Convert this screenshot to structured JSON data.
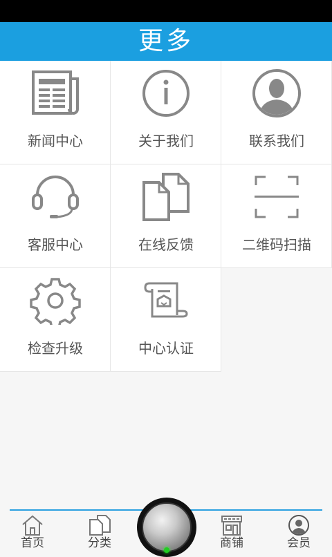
{
  "header": {
    "title": "更多"
  },
  "grid": {
    "items": [
      {
        "label": "新闻中心",
        "icon": "newspaper-icon"
      },
      {
        "label": "关于我们",
        "icon": "info-icon"
      },
      {
        "label": "联系我们",
        "icon": "person-icon"
      },
      {
        "label": "客服中心",
        "icon": "headset-icon"
      },
      {
        "label": "在线反馈",
        "icon": "documents-icon"
      },
      {
        "label": "二维码扫描",
        "icon": "scan-icon"
      },
      {
        "label": "检查升级",
        "icon": "gear-icon"
      },
      {
        "label": "中心认证",
        "icon": "certificate-icon"
      }
    ]
  },
  "tabbar": {
    "tabs": [
      {
        "label": "首页",
        "icon": "home-icon"
      },
      {
        "label": "分类",
        "icon": "category-icon"
      },
      {
        "label": "商铺",
        "icon": "shop-icon"
      },
      {
        "label": "会员",
        "icon": "member-icon"
      }
    ],
    "center_icon": "round-knob-icon"
  },
  "colors": {
    "accent": "#1b9fe0",
    "icon_gray": "#888888",
    "indicator": "#22cc22"
  }
}
